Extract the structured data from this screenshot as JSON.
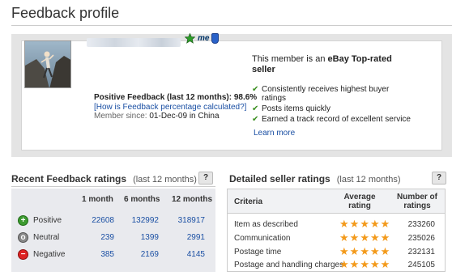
{
  "header": {
    "title": "Feedback profile"
  },
  "profile": {
    "positive_label": "Positive Feedback (last 12 months): 98.6%",
    "help_link": "[How is Feedback percentage calculated?]",
    "member_since_label": "Member since:",
    "member_since_value": "01-Dec-09 in China",
    "me_badge": "me",
    "icons": [
      "star-icon",
      "me-icon",
      "shield-icon"
    ]
  },
  "top_rated": {
    "heading_prefix": "This member is an",
    "heading_bold": "eBay Top-rated seller",
    "benefits": [
      "Consistently receives highest buyer ratings",
      "Posts items quickly",
      "Earned a track record of excellent service"
    ],
    "learn_more": "Learn more"
  },
  "recent": {
    "title": "Recent Feedback ratings",
    "subtitle": "(last 12 months)",
    "help": "?",
    "columns": [
      "1 month",
      "6 months",
      "12 months"
    ],
    "rows": [
      {
        "label": "Positive",
        "symbol": "+",
        "values": [
          "22608",
          "132992",
          "318917"
        ]
      },
      {
        "label": "Neutral",
        "symbol": "o",
        "values": [
          "239",
          "1399",
          "2991"
        ]
      },
      {
        "label": "Negative",
        "symbol": "−",
        "values": [
          "385",
          "2169",
          "4145"
        ]
      }
    ]
  },
  "dsr": {
    "title": "Detailed seller ratings",
    "subtitle": "(last 12 months)",
    "help": "?",
    "columns": [
      "Criteria",
      "Average rating",
      "Number of ratings"
    ],
    "rows": [
      {
        "criteria": "Item as described",
        "stars": 5,
        "count": "233260"
      },
      {
        "criteria": "Communication",
        "stars": 5,
        "count": "235026"
      },
      {
        "criteria": "Postage time",
        "stars": 5,
        "count": "232131"
      },
      {
        "criteria": "Postage and handling charges",
        "stars": 5,
        "count": "245105"
      }
    ]
  },
  "colors": {
    "link": "#1a4fa3",
    "star": "#f39a1b",
    "check": "#3a8f1f",
    "panel": "#e4e4e4"
  }
}
